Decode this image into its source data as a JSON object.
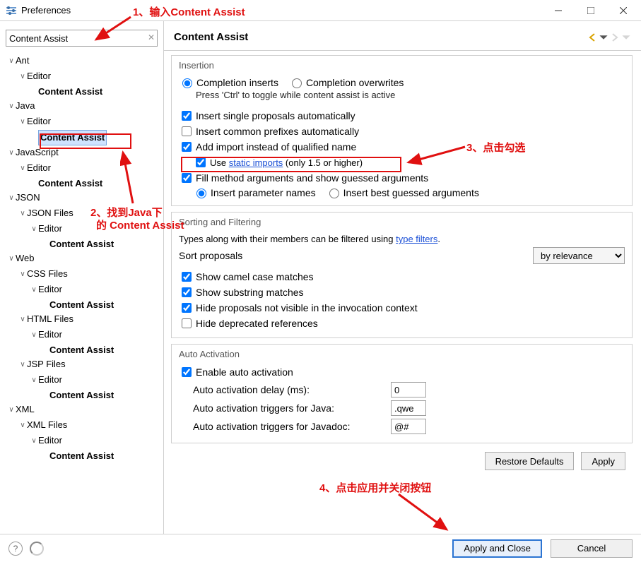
{
  "window": {
    "title": "Preferences"
  },
  "annotations": {
    "a1": "1、输入Content Assist",
    "a2_line1": "2、找到Java下",
    "a2_line2": "的 Content Assist",
    "a3": "3、点击勾选",
    "a4": "4、点击应用并关闭按钮"
  },
  "search": {
    "value": "Content Assist"
  },
  "tree": {
    "ant": "Ant",
    "editor": "Editor",
    "ca": "Content Assist",
    "java": "Java",
    "javascript": "JavaScript",
    "json": "JSON",
    "jsonfiles": "JSON Files",
    "web": "Web",
    "cssfiles": "CSS Files",
    "htmlfiles": "HTML Files",
    "jspfiles": "JSP Files",
    "xml": "XML",
    "xmlfiles": "XML Files"
  },
  "header": {
    "title": "Content Assist"
  },
  "insertion": {
    "group": "Insertion",
    "completion_inserts": "Completion inserts",
    "completion_overwrites": "Completion overwrites",
    "toggle_hint": "Press 'Ctrl' to toggle while content assist is active",
    "insert_single": "Insert single proposals automatically",
    "insert_prefix": "Insert common prefixes automatically",
    "add_import": "Add import instead of qualified name",
    "use_prefix": "Use ",
    "static_imports_link": "static imports",
    "use_suffix": " (only 1.5 or higher)",
    "fill_args": "Fill method arguments and show guessed arguments",
    "insert_param_names": "Insert parameter names",
    "insert_best_guess": "Insert best guessed arguments"
  },
  "sorting": {
    "group": "Sorting and Filtering",
    "types_text": "Types along with their members can be filtered using ",
    "type_filters_link": "type filters",
    "period": ".",
    "sort_label": "Sort proposals",
    "sort_value": "by relevance",
    "camel": "Show camel case matches",
    "substring": "Show substring matches",
    "hide_invoc": "Hide proposals not visible in the invocation context",
    "hide_deprecated": "Hide deprecated references"
  },
  "auto": {
    "group": "Auto Activation",
    "enable": "Enable auto activation",
    "delay_label": "Auto activation delay (ms):",
    "delay_value": "0",
    "java_label": "Auto activation triggers for Java:",
    "java_value": ".qwe",
    "javadoc_label": "Auto activation triggers for Javadoc:",
    "javadoc_value": "@#"
  },
  "buttons": {
    "restore": "Restore Defaults",
    "apply": "Apply",
    "apply_close": "Apply and Close",
    "cancel": "Cancel"
  }
}
